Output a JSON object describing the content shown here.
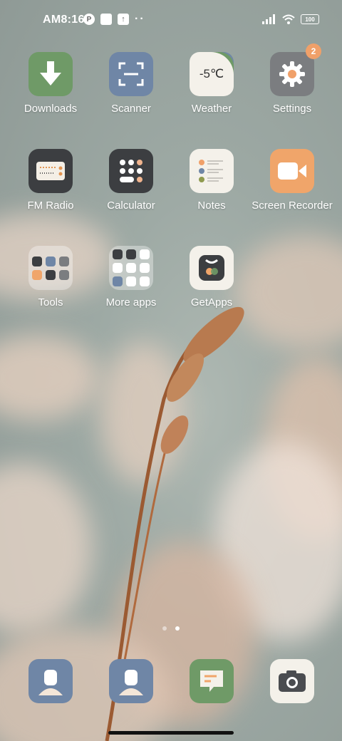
{
  "status_bar": {
    "time": "AM8:16",
    "battery": "100",
    "icons": [
      "notification-icon",
      "square-icon",
      "upload-icon",
      "signal-icon",
      "wifi-icon",
      "battery-icon"
    ]
  },
  "apps": {
    "downloads": {
      "label": "Downloads",
      "color": "#6f9a67"
    },
    "scanner": {
      "label": "Scanner",
      "color": "#6f86a6"
    },
    "weather": {
      "label": "Weather",
      "temp": "-5℃"
    },
    "settings": {
      "label": "Settings",
      "badge": "2"
    },
    "fm_radio": {
      "label": "FM Radio"
    },
    "calculator": {
      "label": "Calculator"
    },
    "notes": {
      "label": "Notes"
    },
    "screen_recorder": {
      "label": "Screen Recorder"
    },
    "tools": {
      "label": "Tools"
    },
    "more_apps": {
      "label": "More apps"
    },
    "getapps": {
      "label": "GetApps"
    }
  },
  "pager": {
    "pages": 2,
    "active": 2
  },
  "dock": [
    "contacts",
    "contacts",
    "messages",
    "camera"
  ]
}
